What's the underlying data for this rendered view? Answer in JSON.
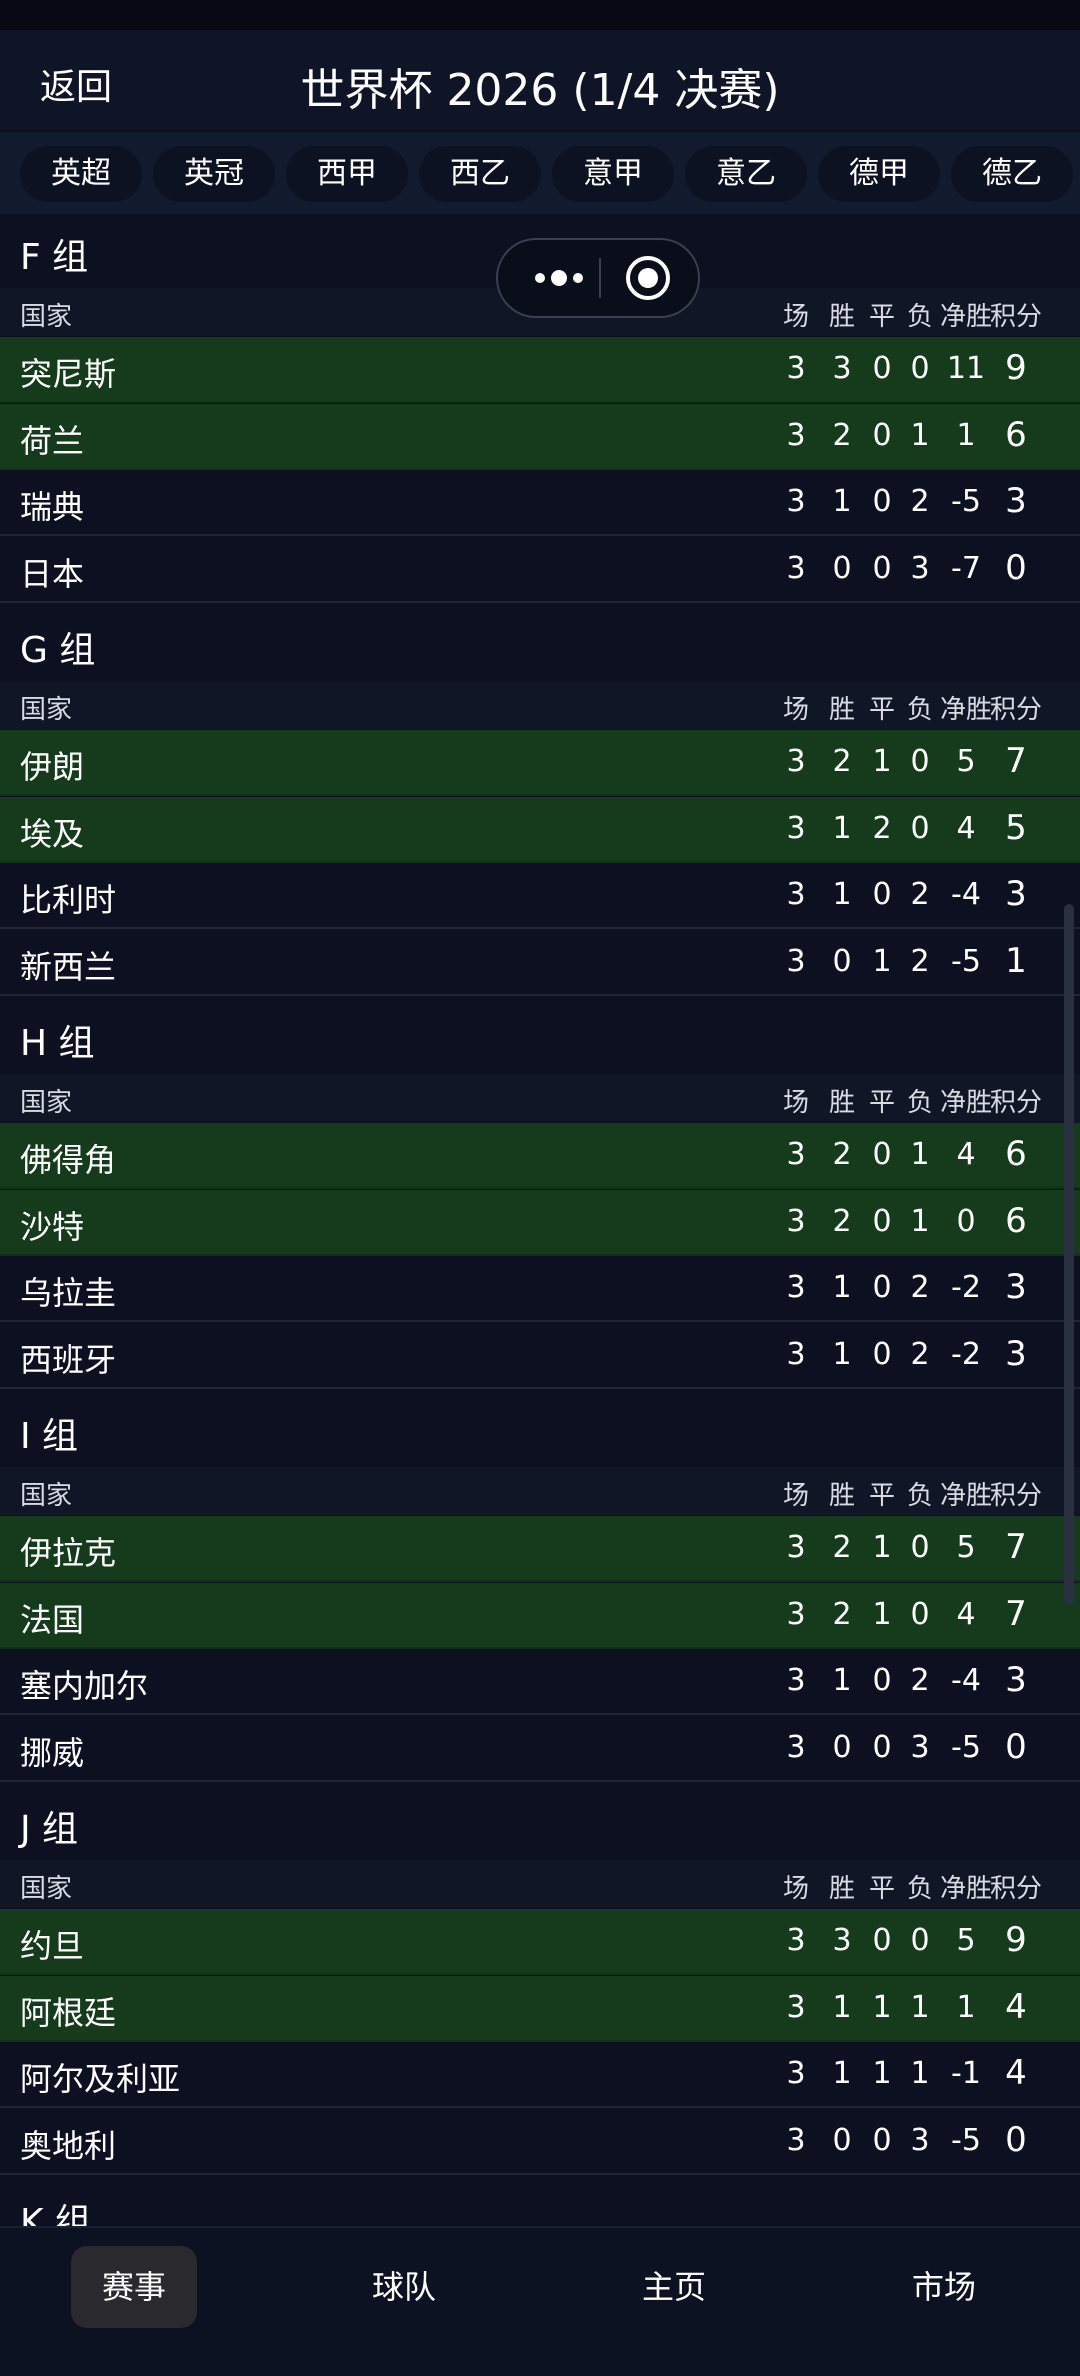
{
  "header": {
    "back_label": "返回",
    "title": "世界杯 2026 (1/4 决赛)"
  },
  "leagues": [
    "英超",
    "英冠",
    "西甲",
    "西乙",
    "意甲",
    "意乙",
    "德甲",
    "德乙"
  ],
  "columns": {
    "country": "国家",
    "played": "场",
    "won": "胜",
    "drawn": "平",
    "lost": "负",
    "gd": "净胜",
    "pts": "积分"
  },
  "groups": [
    {
      "title": "F 组",
      "teams": [
        {
          "name": "突尼斯",
          "p": "3",
          "w": "3",
          "d": "0",
          "l": "0",
          "gd": "11",
          "pts": "9",
          "qualified": true
        },
        {
          "name": "荷兰",
          "p": "3",
          "w": "2",
          "d": "0",
          "l": "1",
          "gd": "1",
          "pts": "6",
          "qualified": true
        },
        {
          "name": "瑞典",
          "p": "3",
          "w": "1",
          "d": "0",
          "l": "2",
          "gd": "-5",
          "pts": "3",
          "qualified": false
        },
        {
          "name": "日本",
          "p": "3",
          "w": "0",
          "d": "0",
          "l": "3",
          "gd": "-7",
          "pts": "0",
          "qualified": false
        }
      ]
    },
    {
      "title": "G 组",
      "teams": [
        {
          "name": "伊朗",
          "p": "3",
          "w": "2",
          "d": "1",
          "l": "0",
          "gd": "5",
          "pts": "7",
          "qualified": true
        },
        {
          "name": "埃及",
          "p": "3",
          "w": "1",
          "d": "2",
          "l": "0",
          "gd": "4",
          "pts": "5",
          "qualified": true
        },
        {
          "name": "比利时",
          "p": "3",
          "w": "1",
          "d": "0",
          "l": "2",
          "gd": "-4",
          "pts": "3",
          "qualified": false
        },
        {
          "name": "新西兰",
          "p": "3",
          "w": "0",
          "d": "1",
          "l": "2",
          "gd": "-5",
          "pts": "1",
          "qualified": false
        }
      ]
    },
    {
      "title": "H 组",
      "teams": [
        {
          "name": "佛得角",
          "p": "3",
          "w": "2",
          "d": "0",
          "l": "1",
          "gd": "4",
          "pts": "6",
          "qualified": true
        },
        {
          "name": "沙特",
          "p": "3",
          "w": "2",
          "d": "0",
          "l": "1",
          "gd": "0",
          "pts": "6",
          "qualified": true
        },
        {
          "name": "乌拉圭",
          "p": "3",
          "w": "1",
          "d": "0",
          "l": "2",
          "gd": "-2",
          "pts": "3",
          "qualified": false
        },
        {
          "name": "西班牙",
          "p": "3",
          "w": "1",
          "d": "0",
          "l": "2",
          "gd": "-2",
          "pts": "3",
          "qualified": false
        }
      ]
    },
    {
      "title": "I 组",
      "teams": [
        {
          "name": "伊拉克",
          "p": "3",
          "w": "2",
          "d": "1",
          "l": "0",
          "gd": "5",
          "pts": "7",
          "qualified": true
        },
        {
          "name": "法国",
          "p": "3",
          "w": "2",
          "d": "1",
          "l": "0",
          "gd": "4",
          "pts": "7",
          "qualified": true
        },
        {
          "name": "塞内加尔",
          "p": "3",
          "w": "1",
          "d": "0",
          "l": "2",
          "gd": "-4",
          "pts": "3",
          "qualified": false
        },
        {
          "name": "挪威",
          "p": "3",
          "w": "0",
          "d": "0",
          "l": "3",
          "gd": "-5",
          "pts": "0",
          "qualified": false
        }
      ]
    },
    {
      "title": "J 组",
      "teams": [
        {
          "name": "约旦",
          "p": "3",
          "w": "3",
          "d": "0",
          "l": "0",
          "gd": "5",
          "pts": "9",
          "qualified": true
        },
        {
          "name": "阿根廷",
          "p": "3",
          "w": "1",
          "d": "1",
          "l": "1",
          "gd": "1",
          "pts": "4",
          "qualified": true
        },
        {
          "name": "阿尔及利亚",
          "p": "3",
          "w": "1",
          "d": "1",
          "l": "1",
          "gd": "-1",
          "pts": "4",
          "qualified": false
        },
        {
          "name": "奥地利",
          "p": "3",
          "w": "0",
          "d": "0",
          "l": "3",
          "gd": "-5",
          "pts": "0",
          "qualified": false
        }
      ]
    },
    {
      "title": "K 组",
      "teams": []
    }
  ],
  "tabs": [
    {
      "label": "赛事",
      "active": true
    },
    {
      "label": "球队",
      "active": false
    },
    {
      "label": "主页",
      "active": false
    },
    {
      "label": "市场",
      "active": false
    }
  ],
  "colors": {
    "qualified_row": "#163b1c",
    "normal_row": "#0c1020",
    "accent_tab": "#2a2a2e"
  },
  "icons": {
    "capsule_menu": "more-dots-icon",
    "capsule_close": "target-icon"
  }
}
